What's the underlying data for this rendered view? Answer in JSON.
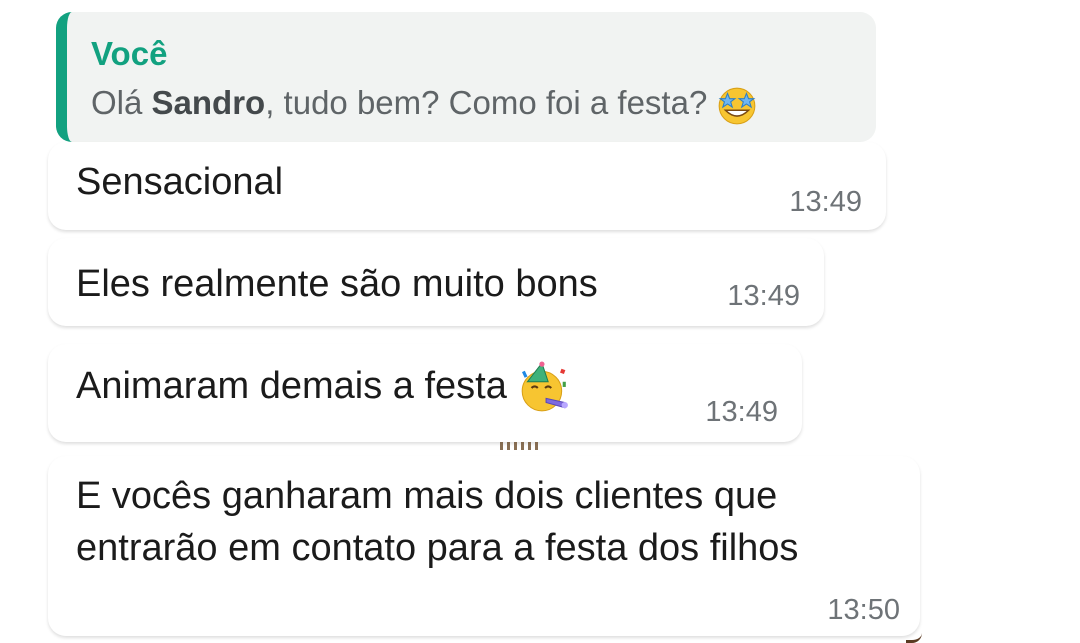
{
  "quoted": {
    "author": "Você",
    "text_before": "Olá ",
    "text_bold": "Sandro",
    "text_after": ", tudo bem? Como foi a festa?",
    "emoji": "star-struck-emoji",
    "accent_color": "#12a180"
  },
  "messages": [
    {
      "text": "Sensacional",
      "time": "13:49"
    },
    {
      "text": "Eles realmente são muito bons",
      "time": "13:49"
    },
    {
      "text": "Animaram demais a festa",
      "time": "13:49",
      "emoji": "partying-face-emoji"
    },
    {
      "text": "E vocês ganharam mais dois clientes que entrarão em contato para a festa dos filhos",
      "time": "13:50"
    }
  ]
}
